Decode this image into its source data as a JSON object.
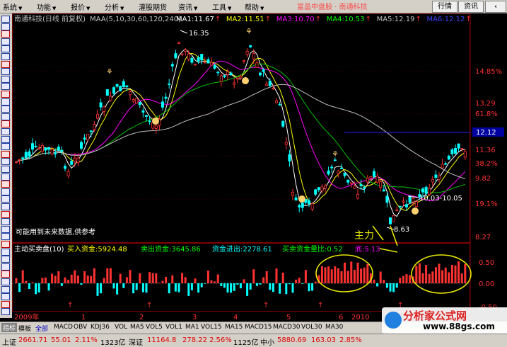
{
  "menu": {
    "items": [
      "系统",
      "功能",
      "报价",
      "分析",
      "灌股期货",
      "资讯",
      "工具",
      "帮助"
    ],
    "quote_title": "富晶中盘股 · 南通科技",
    "buttons": [
      "行情",
      "资讯"
    ],
    "back": "‹"
  },
  "chart": {
    "title": "南通科技(日线 前复权)",
    "ma_label": "MAA(5,10,30,60,120,240)",
    "ma_values": [
      {
        "name": "MA1",
        "value": "11.67",
        "color": "#ffffff"
      },
      {
        "name": "MA2",
        "value": "11.51",
        "color": "#ffff00"
      },
      {
        "name": "MA3",
        "value": "10.70",
        "color": "#ff00ff"
      },
      {
        "name": "MA4",
        "value": "10.53",
        "color": "#00ff00"
      },
      {
        "name": "MA5",
        "value": "12.19",
        "color": "#c0c0c0"
      },
      {
        "name": "MA6",
        "value": "12.12",
        "color": "#4040ff"
      }
    ],
    "price_axis": [
      "14.85%",
      "13.29",
      "61.8%",
      "11.36",
      "38.2%",
      "9.82",
      "19.1%",
      "8.27"
    ],
    "current_price": "12.12",
    "annotations": {
      "high": "16.35",
      "low": "8.63",
      "range": "10.03-10.05"
    },
    "notice": "可能用到未来数据,供参考",
    "colors": {
      "up": "#ff3232",
      "down": "#00ffff",
      "ma5": "#ffffff",
      "ma10": "#ffff00",
      "ma30": "#ff00ff",
      "ma60": "#00c000",
      "ma120": "#c0c0c0",
      "ma240": "#4040ff"
    }
  },
  "indicator": {
    "name": "主动买卖盘(10)",
    "buy_label": "买入资金:",
    "buy_value": "5924.48",
    "sell_label": "卖出资金:",
    "sell_value": "3645.86",
    "net_label": "资金进出:",
    "net_value": "2278.61",
    "ratio_label": "买卖资金量比:",
    "ratio_value": "0.52",
    "extra": "底:5.13",
    "axis": [
      "0.50",
      "0.00",
      "-0.50"
    ],
    "handwriting": "主力"
  },
  "timeline": {
    "labels": [
      "2009年",
      "1",
      "2",
      "3",
      "4",
      "5",
      "6",
      "2010"
    ]
  },
  "tabs": {
    "items": [
      "指标",
      "模板",
      "全部",
      "MACD",
      "OBV",
      "KDJ36",
      "VOL",
      "MA5",
      "VOL5",
      "VOL1",
      "MA1",
      "VOL15",
      "MA15",
      "MACD15",
      "MACD30",
      "VOL30",
      "MA30"
    ],
    "selected": "指标"
  },
  "status": {
    "sh_label": "上证",
    "sh_index": "2661.71",
    "sh_change": "55.01",
    "sh_pct": "2.11%",
    "sh_vol": "1323亿",
    "sz_label": "深证",
    "sz_index": "11164.8",
    "sz_change": "278.22",
    "sz_pct": "2.56%",
    "sz_vol": "1125亿",
    "zx_label": "中小",
    "zx_index": "5880.69",
    "zx_change": "163.03",
    "zx_pct": "2.85%"
  },
  "watermark": {
    "text": "分析家公式网",
    "url": "www.88gs.com"
  }
}
